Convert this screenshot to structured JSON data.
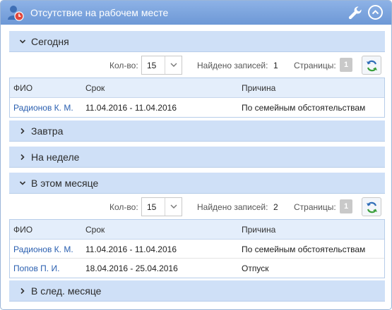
{
  "widget": {
    "title": "Отсутствие на рабочем месте",
    "icons": {
      "app": "person-clock-icon",
      "settings": "wrench-icon",
      "collapse": "chevron-up-circle-icon"
    },
    "colors": {
      "titlebar": "#7aa2dc",
      "section": "#cfe0f7",
      "link": "#2a5fb0"
    }
  },
  "labels": {
    "count": "Кол-во:",
    "found": "Найдено записей:",
    "pages": "Страницы:"
  },
  "columns": [
    "ФИО",
    "Срок",
    "Причина"
  ],
  "sections": [
    {
      "label": "Сегодня",
      "expanded": true,
      "page_size": "15",
      "found": "1",
      "page": "1",
      "rows": [
        {
          "name": "Радионов К. М.",
          "period": "11.04.2016 - 11.04.2016",
          "reason": "По семейным обстоятельствам"
        }
      ]
    },
    {
      "label": "Завтра",
      "expanded": false
    },
    {
      "label": "На неделе",
      "expanded": false
    },
    {
      "label": "В этом месяце",
      "expanded": true,
      "page_size": "15",
      "found": "2",
      "page": "1",
      "rows": [
        {
          "name": "Радионов К. М.",
          "period": "11.04.2016 - 11.04.2016",
          "reason": "По семейным обстоятельствам"
        },
        {
          "name": "Попов П. И.",
          "period": "18.04.2016 - 25.04.2016",
          "reason": "Отпуск"
        }
      ]
    },
    {
      "label": "В след. месяце",
      "expanded": false
    }
  ]
}
